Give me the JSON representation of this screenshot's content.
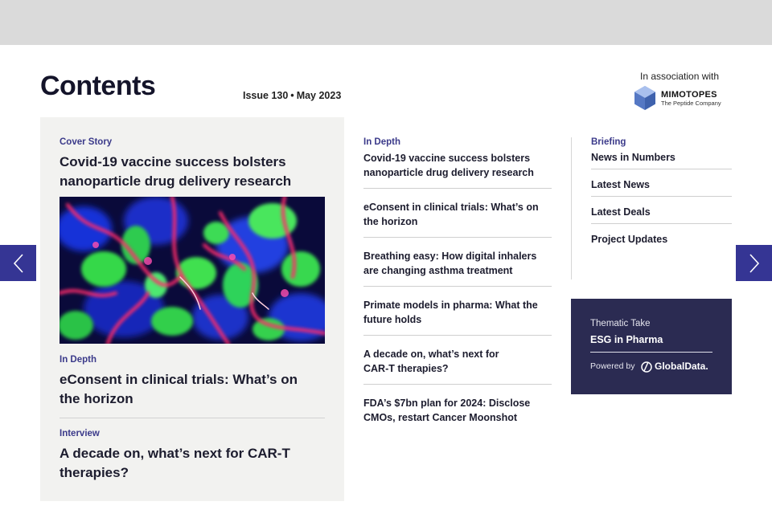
{
  "header": {
    "title": "Contents",
    "issue_label": "Issue 130",
    "issue_separator": "•",
    "issue_date": "May 2023"
  },
  "association": {
    "label": "In association with",
    "logo_name": "MIMOTOPES",
    "logo_tagline": "The Peptide Company"
  },
  "cover": {
    "items": [
      {
        "kicker": "Cover Story",
        "headline": "Covid-19 vaccine success bolsters nanoparticle drug delivery research"
      },
      {
        "kicker": "In Depth",
        "headline": "eConsent in clinical trials: What’s on the horizon"
      },
      {
        "kicker": "Interview",
        "headline": "A decade on, what’s next for CAR-T therapies?"
      }
    ]
  },
  "in_depth": {
    "kicker": "In Depth",
    "items": [
      {
        "line1": "Covid-19 vaccine success bolsters",
        "line2": "nanoparticle drug delivery research"
      },
      {
        "line1": "eConsent in clinical trials: What’s on",
        "line2": "the horizon"
      },
      {
        "line1": "Breathing easy: How digital inhalers",
        "line2": "are changing asthma treatment"
      },
      {
        "line1": "Primate models in pharma: What the",
        "line2": "future holds"
      },
      {
        "line1": "A decade on, what’s next for",
        "line2": "CAR-T therapies?"
      },
      {
        "line1": "FDA’s $7bn plan for 2024: Disclose",
        "line2": "CMOs, restart Cancer Moonshot"
      }
    ]
  },
  "briefing": {
    "kicker": "Briefing",
    "items": [
      "News in Numbers",
      "Latest News",
      "Latest Deals",
      "Project Updates"
    ]
  },
  "thematic": {
    "label": "Thematic Take",
    "title": "ESG in Pharma",
    "powered_by": "Powered by",
    "partner": "GlobalData."
  },
  "colors": {
    "accent": "#353594",
    "kicker": "#3b3a8a",
    "thematic_bg": "#2b2b52",
    "panel_bg": "#f2f2f0",
    "topbar": "#dadada"
  },
  "icons": {
    "prev": "chevron-left-icon",
    "next": "chevron-right-icon"
  }
}
